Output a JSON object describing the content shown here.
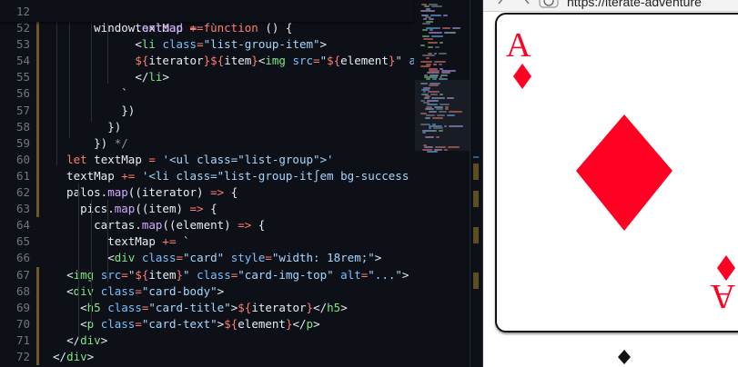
{
  "editor": {
    "sticky_line": {
      "number": "12",
      "code": "window.onload = function () {"
    },
    "lines": [
      {
        "number": "52",
        "code": "            textMap += `"
      },
      {
        "number": "53",
        "code": "            <li class=\"list-group-item\">"
      },
      {
        "number": "54",
        "code": "            ${iterator}${item}<img src=\"${element}\" alt=\""
      },
      {
        "number": "55",
        "code": "            </li>"
      },
      {
        "number": "56",
        "code": "          `"
      },
      {
        "number": "57",
        "code": "          })"
      },
      {
        "number": "58",
        "code": "        })"
      },
      {
        "number": "59",
        "code": "      }) */"
      },
      {
        "number": "60",
        "code": "  let textMap = '<ul class=\"list-group\">'"
      },
      {
        "number": "61",
        "code": "  textMap += '<li class=\"list-group-it∫em bg-success te"
      },
      {
        "number": "62",
        "code": "  palos.map((iterator) => {"
      },
      {
        "number": "63",
        "code": "    pics.map((item) => {"
      },
      {
        "number": "64",
        "code": "      cartas.map((element) => {"
      },
      {
        "number": "65",
        "code": "        textMap += `"
      },
      {
        "number": "66",
        "code": "        <div class=\"card\" style=\"width: 18rem;\">"
      },
      {
        "number": "67",
        "code": "  <img src=\"${item}\" class=\"card-img-top\" alt=\"...\">"
      },
      {
        "number": "68",
        "code": "  <div class=\"card-body\">"
      },
      {
        "number": "69",
        "code": "    <h5 class=\"card-title\">${iterator}</h5>"
      },
      {
        "number": "70",
        "code": "    <p class=\"card-text\">${element}</p>"
      },
      {
        "number": "71",
        "code": "  </div>"
      },
      {
        "number": "72",
        "code": "</div>"
      }
    ]
  },
  "browser": {
    "url": "https://iterate-adventure",
    "card": {
      "rank": "A",
      "suit": "diamonds",
      "color": "#ff0022"
    }
  },
  "colors": {
    "editor_bg": "#0d1117",
    "keyword": "#ff7b72",
    "function": "#d2a8ff",
    "string": "#a5d6ff",
    "tag": "#7ee787",
    "attribute": "#79c0ff",
    "line_number": "#6e7681",
    "card_red": "#ff0022"
  }
}
